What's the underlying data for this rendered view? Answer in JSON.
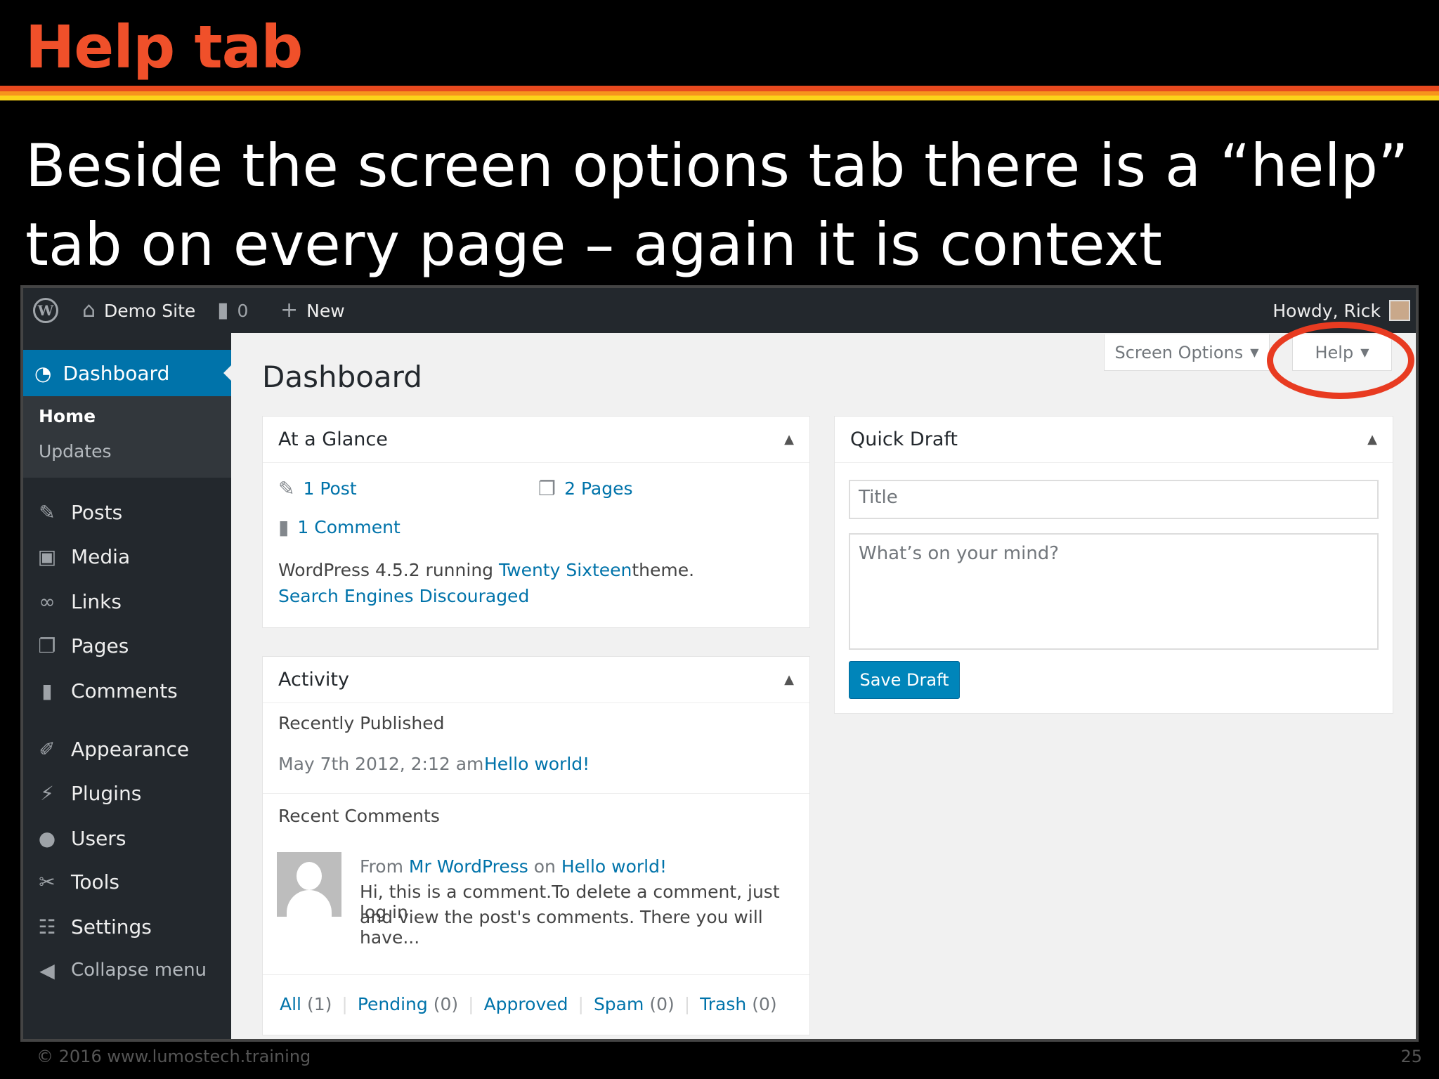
{
  "slide": {
    "title": "Help tab",
    "body": "Beside the screen options tab there is a “help” tab on every page – again it is context sensitive.",
    "footer_left": "© 2016  www.lumostech.training",
    "page_number": "25"
  },
  "adminbar": {
    "site": "Demo Site",
    "comments_count": "0",
    "new": "New",
    "howdy": "Howdy, Rick"
  },
  "sidebar": {
    "current": "Dashboard",
    "sub_home": "Home",
    "sub_updates": "Updates",
    "items": [
      "Posts",
      "Media",
      "Links",
      "Pages",
      "Comments",
      "Appearance",
      "Plugins",
      "Users",
      "Tools",
      "Settings"
    ],
    "collapse": "Collapse menu"
  },
  "main": {
    "title": "Dashboard",
    "screen_options": "Screen Options",
    "help": "Help"
  },
  "glance": {
    "title": "At a Glance",
    "posts": "1 Post",
    "pages": "2 Pages",
    "comments": "1 Comment",
    "wp_prefix": "WordPress 4.5.2 running ",
    "theme": "Twenty Sixteen",
    "wp_suffix": " theme.",
    "search_engines": "Search Engines Discouraged"
  },
  "activity": {
    "title": "Activity",
    "recently_published": "Recently Published",
    "date": "May 7th 2012, 2:12 am",
    "post_link": "Hello world!",
    "recent_comments": "Recent Comments",
    "from": "From ",
    "author": "Mr WordPress",
    "on": " on ",
    "comment_post": "Hello world!",
    "excerpt_1": "Hi, this is a comment.To delete a comment, just log in",
    "excerpt_2": "and view the post's comments. There you will have...",
    "filters": [
      {
        "label": "All",
        "count": "(1)"
      },
      {
        "label": "Pending",
        "count": "(0)"
      },
      {
        "label": "Approved",
        "count": ""
      },
      {
        "label": "Spam",
        "count": "(0)"
      },
      {
        "label": "Trash",
        "count": "(0)"
      }
    ]
  },
  "quick_draft": {
    "title": "Quick Draft",
    "title_placeholder": "Title",
    "content_placeholder": "What’s on your mind?",
    "save": "Save Draft"
  },
  "colors": {
    "title_orange": "#f0502a",
    "wp_blue": "#0073aa",
    "adminbar": "#23282d",
    "highlight": "#e83b21"
  }
}
